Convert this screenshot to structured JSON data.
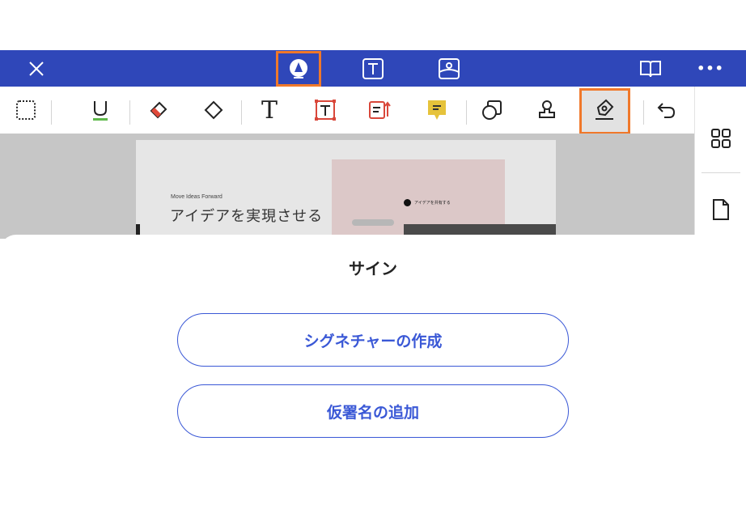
{
  "top_bar": {
    "close_icon": "close-icon",
    "center_icons": [
      "pen-tool-icon",
      "text-icon",
      "image-icon"
    ],
    "right_icons": [
      "book-icon",
      "more-icon"
    ],
    "more_label": "•••"
  },
  "toolbar": {
    "tools": [
      "marquee-select",
      "underline",
      "highlighter-eraser",
      "eraser",
      "text",
      "text-box",
      "text-callout",
      "sticky-note",
      "shapes",
      "stamp",
      "sign",
      "undo"
    ],
    "text_tool_label": "T"
  },
  "document": {
    "small_caption": "Move Ideas Forward",
    "headline": "アイデアを実現させる",
    "share_label": "アイデアを共有する"
  },
  "sheet": {
    "title": "サイン",
    "create_signature": "シグネチャーの作成",
    "add_initials": "仮署名の追加"
  },
  "colors": {
    "top_bar": "#2f47b9",
    "highlight": "#f0782a",
    "accent": "#3a58d6"
  }
}
